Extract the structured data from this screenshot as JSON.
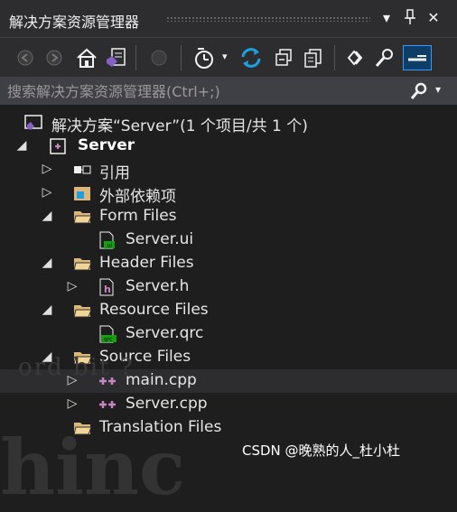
{
  "window": {
    "title": "解决方案资源管理器",
    "controls": [
      "dropdown",
      "pin",
      "close"
    ]
  },
  "toolbar": {
    "buttons": [
      "back",
      "forward",
      "home",
      "vs-solution",
      "sync",
      "history",
      "refresh",
      "collapse-all",
      "copy",
      "show-all",
      "properties",
      "preview"
    ]
  },
  "search": {
    "placeholder": "搜索解决方案资源管理器(Ctrl+;)"
  },
  "tree": {
    "solution": "解决方案“Server”(1 个项目/共 1 个)",
    "project": "Server",
    "references": "引用",
    "external_deps": "外部依赖项",
    "form_files": "Form Files",
    "server_ui": "Server.ui",
    "header_files": "Header Files",
    "server_h": "Server.h",
    "resource_files": "Resource Files",
    "server_qrc": "Server.qrc",
    "source_files": "Source Files",
    "main_cpp": "main.cpp",
    "server_cpp": "Server.cpp",
    "translation_files": "Translation Files"
  },
  "background": {
    "watermark_a": "ord   bit  ?",
    "watermark_b": "hinc"
  },
  "footer": {
    "credit": "CSDN @晚熟的人_杜小杜"
  },
  "colors": {
    "panel": "#1e1e1e",
    "chrome": "#2d2d30",
    "accent": "#3399ff",
    "folder": "#dcb67a",
    "cpp": "#c586c0"
  }
}
